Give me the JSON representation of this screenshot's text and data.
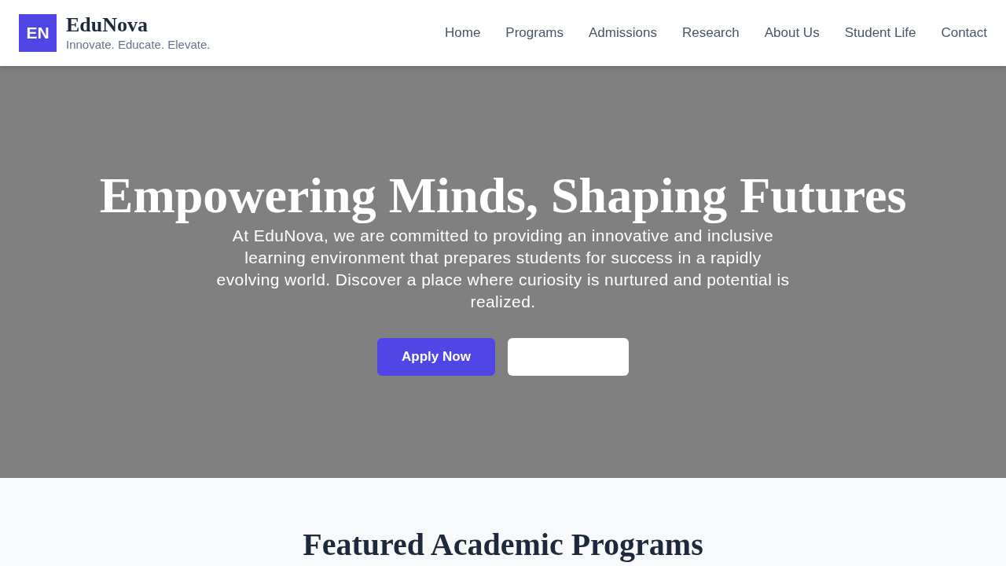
{
  "header": {
    "logo_mark": "EN",
    "brand": "EduNova",
    "tagline": "Innovate. Educate. Elevate.",
    "nav": [
      "Home",
      "Programs",
      "Admissions",
      "Research",
      "About Us",
      "Student Life",
      "Contact"
    ]
  },
  "hero": {
    "title": "Empowering Minds, Shaping Futures",
    "text": "At EduNova, we are committed to providing an innovative and inclusive learning environment that prepares students for success in a rapidly evolving world. Discover a place where curiosity is nurtured and potential is realized.",
    "buttons": [
      {
        "kind": "primary",
        "label": "Apply Now"
      },
      {
        "kind": "secondary"
      }
    ]
  },
  "programs": {
    "heading": "Featured Academic Programs"
  }
}
